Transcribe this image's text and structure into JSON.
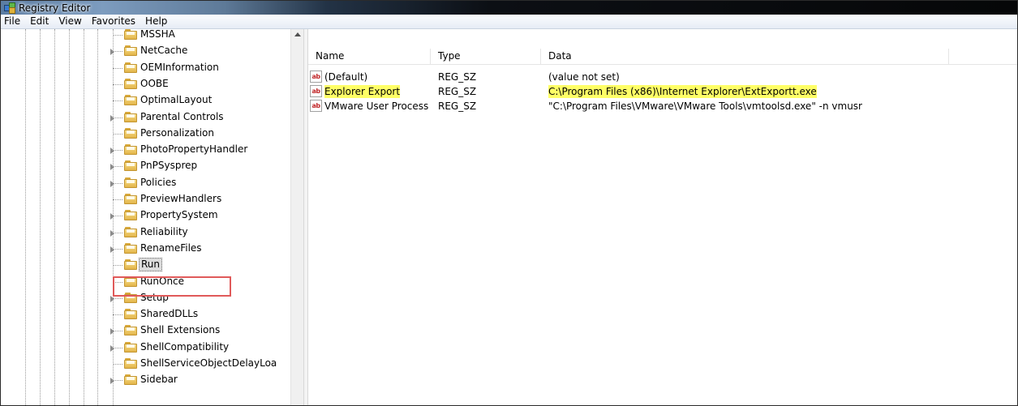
{
  "window": {
    "title": "Registry Editor"
  },
  "menu": [
    "File",
    "Edit",
    "View",
    "Favorites",
    "Help"
  ],
  "tree": {
    "items": [
      {
        "label": "MSSHA",
        "expandable": false
      },
      {
        "label": "NetCache",
        "expandable": true
      },
      {
        "label": "OEMInformation",
        "expandable": false
      },
      {
        "label": "OOBE",
        "expandable": false
      },
      {
        "label": "OptimalLayout",
        "expandable": false
      },
      {
        "label": "Parental Controls",
        "expandable": true
      },
      {
        "label": "Personalization",
        "expandable": false
      },
      {
        "label": "PhotoPropertyHandler",
        "expandable": true
      },
      {
        "label": "PnPSysprep",
        "expandable": true
      },
      {
        "label": "Policies",
        "expandable": true
      },
      {
        "label": "PreviewHandlers",
        "expandable": false
      },
      {
        "label": "PropertySystem",
        "expandable": true
      },
      {
        "label": "Reliability",
        "expandable": true
      },
      {
        "label": "RenameFiles",
        "expandable": true
      },
      {
        "label": "Run",
        "expandable": false,
        "selected": true
      },
      {
        "label": "RunOnce",
        "expandable": false
      },
      {
        "label": "Setup",
        "expandable": true
      },
      {
        "label": "SharedDLLs",
        "expandable": false
      },
      {
        "label": "Shell Extensions",
        "expandable": true
      },
      {
        "label": "ShellCompatibility",
        "expandable": true
      },
      {
        "label": "ShellServiceObjectDelayLoa",
        "expandable": false
      },
      {
        "label": "Sidebar",
        "expandable": true
      }
    ]
  },
  "list": {
    "columns": [
      "Name",
      "Type",
      "Data"
    ],
    "rows": [
      {
        "name": "(Default)",
        "type": "REG_SZ",
        "data": "(value not set)",
        "highlight": false
      },
      {
        "name": "Explorer Export",
        "type": "REG_SZ",
        "data": "C:\\Program Files (x86)\\Internet Explorer\\ExtExportt.exe",
        "highlight": true
      },
      {
        "name": "VMware User Process",
        "type": "REG_SZ",
        "data": "\"C:\\Program Files\\VMware\\VMware Tools\\vmtoolsd.exe\" -n vmusr",
        "highlight": false
      }
    ],
    "value_icon": "ab",
    "highlight_color": "#ffff66"
  },
  "annotation": {
    "color": "#e05a5a"
  }
}
